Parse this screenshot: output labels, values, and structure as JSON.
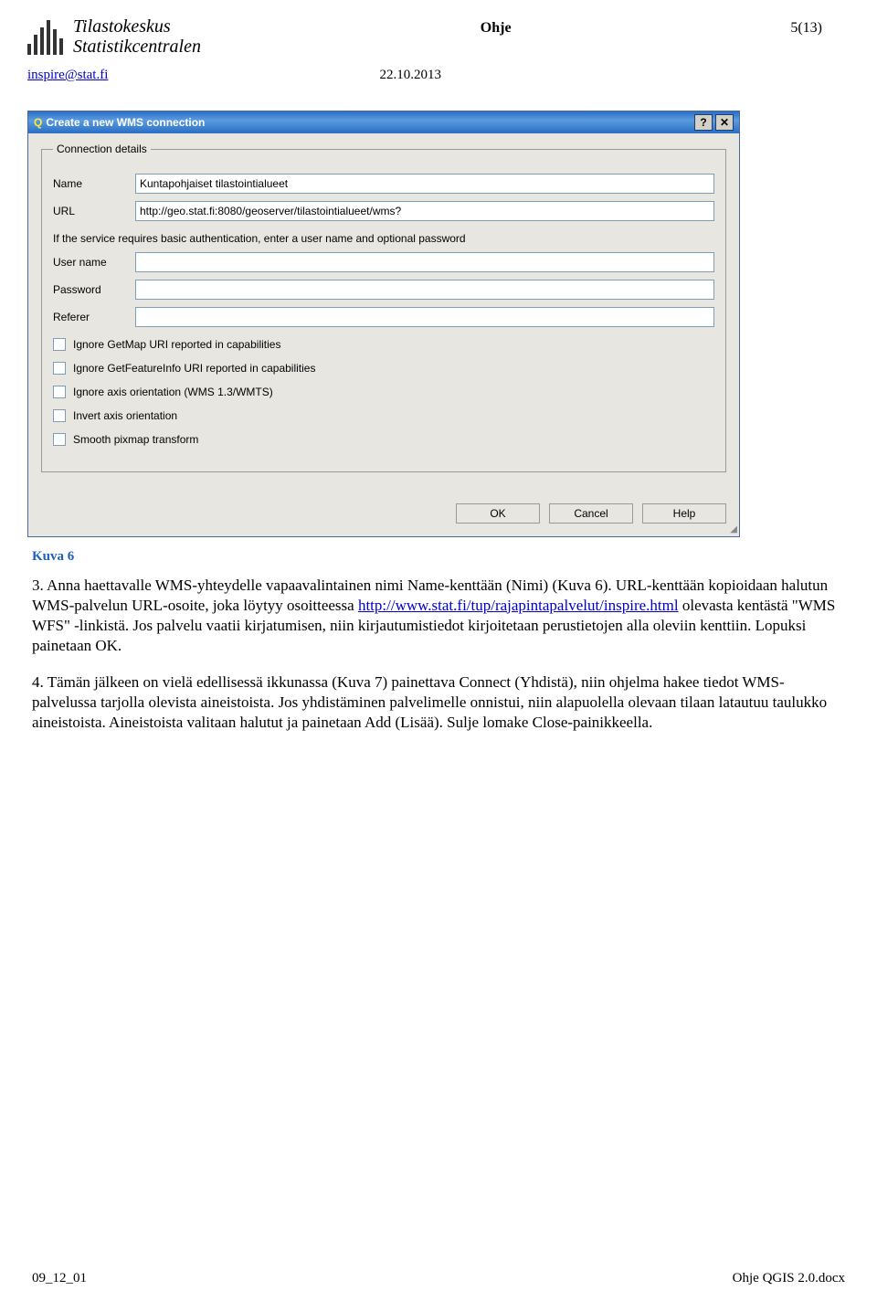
{
  "header": {
    "logo_line1": "Tilastokeskus",
    "logo_line2": "Statistikcentralen",
    "title": "Ohje",
    "page_info": "5(13)",
    "email": "inspire@stat.fi",
    "date": "22.10.2013"
  },
  "dialog": {
    "title": "Create a new WMS connection",
    "legend": "Connection details",
    "labels": {
      "name": "Name",
      "url": "URL",
      "user": "User name",
      "password": "Password",
      "referer": "Referer"
    },
    "values": {
      "name": "Kuntapohjaiset tilastointialueet",
      "url": "http://geo.stat.fi:8080/geoserver/tilastointialueet/wms?",
      "user": "",
      "password": "",
      "referer": ""
    },
    "auth_note": "If the service requires basic authentication, enter a user name and optional password",
    "checks": [
      "Ignore GetMap URI reported in capabilities",
      "Ignore GetFeatureInfo URI reported in capabilities",
      "Ignore axis orientation (WMS 1.3/WMTS)",
      "Invert axis orientation",
      "Smooth pixmap transform"
    ],
    "buttons": {
      "ok": "OK",
      "cancel": "Cancel",
      "help": "Help"
    },
    "helpbtn": "?"
  },
  "body": {
    "caption": "Kuva 6",
    "p1a": "3. Anna haettavalle WMS-yhteydelle vapaavalintainen nimi Name-kenttään (Nimi) (Kuva 6). URL-kenttään kopioidaan halutun WMS-palvelun URL-osoite, joka löytyy osoitteessa ",
    "p1_link": "http://www.stat.fi/tup/rajapintapalvelut/inspire.html",
    "p1b": " olevasta kentästä \"WMS WFS\" -linkistä. Jos palvelu vaatii kirjatumisen, niin kirjautumistiedot kirjoitetaan perustietojen alla oleviin kenttiin. Lopuksi painetaan OK.",
    "p2": "4. Tämän jälkeen on vielä edellisessä ikkunassa (Kuva 7) painettava Connect (Yhdistä), niin ohjelma hakee tiedot WMS-palvelussa tarjolla olevista aineistoista. Jos yhdistäminen palvelimelle onnistui, niin alapuolella olevaan tilaan latautuu taulukko aineistoista. Aineistoista valitaan halutut ja painetaan Add (Lisää). Sulje lomake Close-painikkeella."
  },
  "footer": {
    "left": "09_12_01",
    "right": "Ohje QGIS 2.0.docx"
  }
}
